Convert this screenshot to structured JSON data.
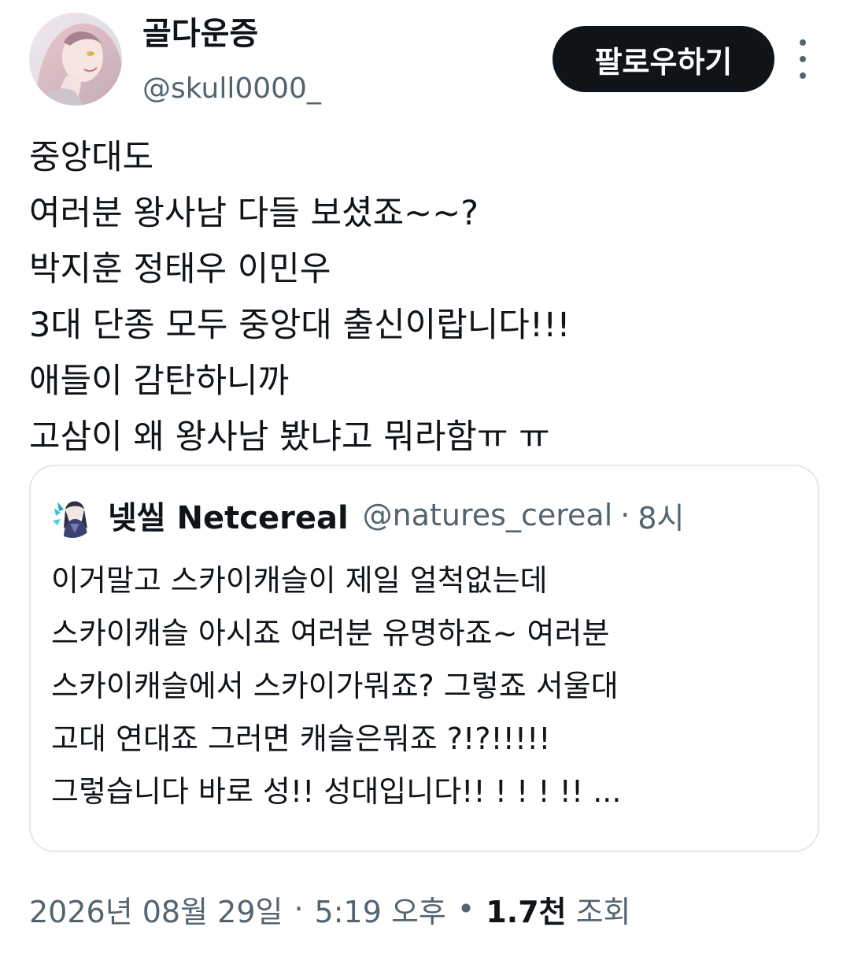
{
  "author": {
    "display_name": "골다운증",
    "handle": "@skull0000_"
  },
  "actions": {
    "follow_label": "팔로우하기",
    "more_icon": "more-vertical-icon"
  },
  "tweet": {
    "lines": [
      "중앙대도",
      "여러분 왕사남 다들 보셨죠~~?",
      "박지훈 정태우 이민우",
      "3대 단종 모두 중앙대 출신이랍니다!!!",
      "애들이 감탄하니까",
      "고삼이 왜 왕사남 봤냐고 뭐라함ㅠ ㅠ"
    ]
  },
  "quote": {
    "author_name": "넺씰 Netcereal",
    "author_handle": "@natures_cereal",
    "separator": "·",
    "time": "8시",
    "lines": [
      "이거말고 스카이캐슬이 제일 얼척없는데",
      "스카이캐슬 아시죠 여러분 유명하죠~ 여러분",
      "스카이캐슬에서 스카이가뭐죠? 그렇죠 서울대",
      "고대 연대죠 그러면 캐슬은뭐죠 ?!?!!!!!",
      "그렇습니다 바로 성!! 성대입니다!! ! ! ! !! ..."
    ]
  },
  "meta": {
    "date": "2026년 08월 29일",
    "separator": "·",
    "time": "5:19 오후",
    "separator2": "•",
    "views_count": "1.7천",
    "views_label": "조회"
  },
  "colors": {
    "text_primary": "#0f1419",
    "text_secondary": "#536471",
    "button_bg": "#0f1419",
    "card_border": "#e1e8ed"
  }
}
